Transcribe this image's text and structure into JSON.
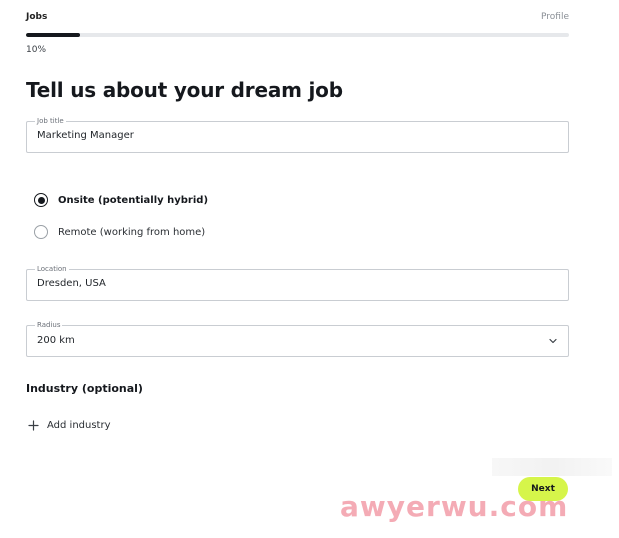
{
  "progress": {
    "left_label": "Jobs",
    "right_label": "Profile",
    "percent_text": "10%",
    "value": 0.1
  },
  "heading": {
    "title": "Tell us about your dream job"
  },
  "job_title": {
    "label": "Job title",
    "value": "Marketing Manager"
  },
  "work_type": {
    "options": [
      {
        "label": "Onsite (potentially hybrid)",
        "checked": true
      },
      {
        "label": "Remote (working from home)",
        "checked": false
      }
    ]
  },
  "location": {
    "label": "Location",
    "value": "Dresden, USA"
  },
  "radius": {
    "label": "Radius",
    "value": "200 km"
  },
  "industry": {
    "title": "Industry (optional)",
    "add_label": "Add industry"
  },
  "footer": {
    "next_label": "Next",
    "watermark": "awyerwu.com"
  },
  "colors": {
    "accent": "#d6f54a",
    "progress": "#15181d"
  },
  "icons": {
    "select": "chevron-down-icon",
    "add": "plus-icon"
  }
}
